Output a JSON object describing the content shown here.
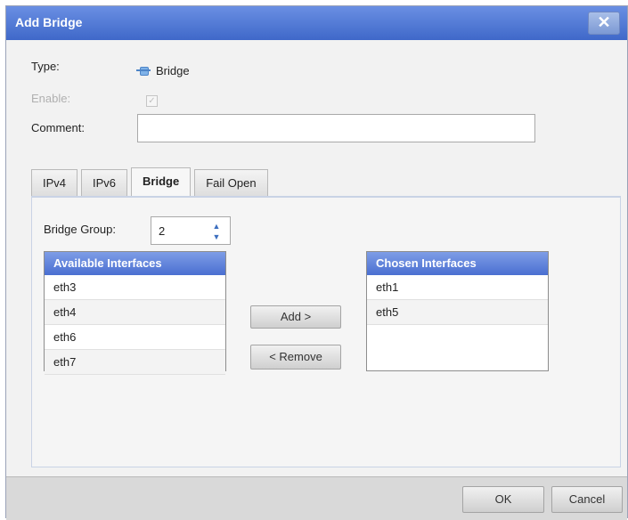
{
  "dialog": {
    "title": "Add Bridge",
    "close_label": "✕"
  },
  "form": {
    "type_label": "Type:",
    "type_value": "Bridge",
    "enable_label": "Enable:",
    "comment_label": "Comment:",
    "comment_value": ""
  },
  "tabs": [
    {
      "label": "IPv4",
      "active": false
    },
    {
      "label": "IPv6",
      "active": false
    },
    {
      "label": "Bridge",
      "active": true
    },
    {
      "label": "Fail Open",
      "active": false
    }
  ],
  "bridge": {
    "group_label": "Bridge Group:",
    "group_value": "2",
    "available_header": "Available Interfaces",
    "available": [
      "eth3",
      "eth4",
      "eth6",
      "eth7"
    ],
    "chosen_header": "Chosen Interfaces",
    "chosen": [
      "eth1",
      "eth5"
    ],
    "add_label": "Add >",
    "remove_label": "< Remove"
  },
  "footer": {
    "ok_label": "OK",
    "cancel_label": "Cancel"
  }
}
